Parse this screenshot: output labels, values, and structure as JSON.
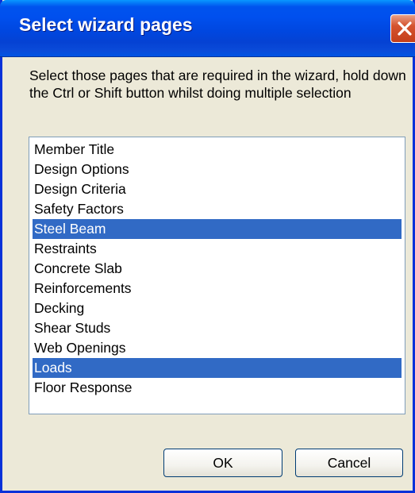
{
  "dialog": {
    "title": "Select wizard pages",
    "instructions": "Select those pages that are required in the wizard, hold down the Ctrl or Shift button whilst doing multiple selection",
    "list": {
      "items": [
        {
          "label": "Member Title",
          "selected": false
        },
        {
          "label": "Design Options",
          "selected": false
        },
        {
          "label": "Design Criteria",
          "selected": false
        },
        {
          "label": "Safety Factors",
          "selected": false
        },
        {
          "label": "Steel Beam",
          "selected": true
        },
        {
          "label": "Restraints",
          "selected": false
        },
        {
          "label": "Concrete Slab",
          "selected": false
        },
        {
          "label": "Reinforcements",
          "selected": false
        },
        {
          "label": "Decking",
          "selected": false
        },
        {
          "label": "Shear Studs",
          "selected": false
        },
        {
          "label": "Web Openings",
          "selected": false
        },
        {
          "label": "Loads",
          "selected": true
        },
        {
          "label": "Floor Response",
          "selected": false
        }
      ]
    },
    "buttons": {
      "ok": "OK",
      "cancel": "Cancel"
    }
  },
  "icons": {
    "close": "close-icon"
  },
  "colors": {
    "titlebar": "#0054e3",
    "selection": "#316ac5",
    "dialog_face": "#ece9d8",
    "close_button": "#d5532f"
  }
}
